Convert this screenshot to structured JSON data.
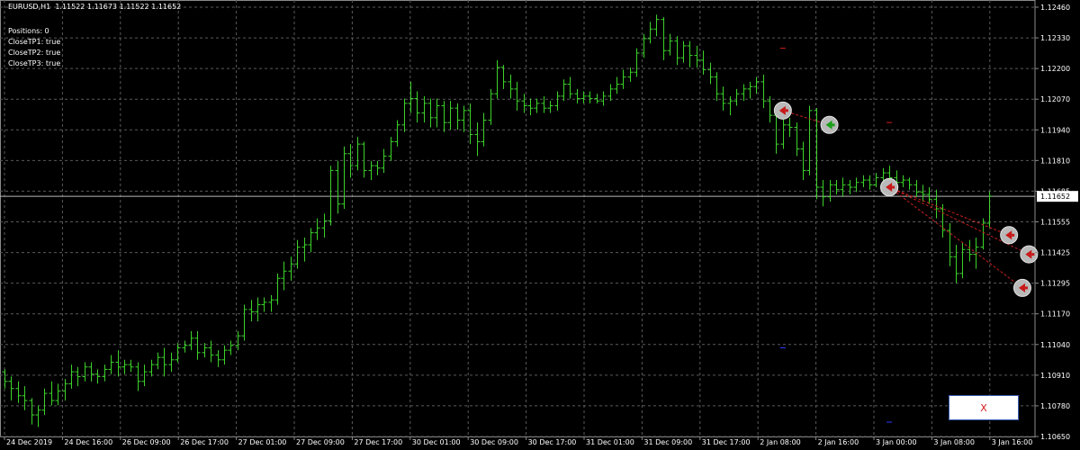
{
  "header": {
    "symbol": "EURUSD,H1",
    "ohlc": "1.11522 1.11673 1.11522 1.11652"
  },
  "info": {
    "lines": [
      "Positions: 0",
      "CloseTP1: true",
      "CloseTP2: true",
      "CloseTP3: true"
    ]
  },
  "close_button": {
    "label": "X"
  },
  "colors": {
    "background": "#000000",
    "grid": "#5a5a5a",
    "bar": "#3cd22a",
    "axis_text": "#ffffff",
    "price_tag_bg": "#ffffff",
    "price_tag_text": "#000000",
    "trade_line": "#c41e1e",
    "marker_fill": "#b9b9b9",
    "marker_arrow_green": "#18a018",
    "marker_arrow_red": "#c81818",
    "level_red": "#d81c1c",
    "level_blue": "#2a3cff"
  },
  "chart_data": {
    "type": "ohlc",
    "symbol": "EURUSD",
    "timeframe": "H1",
    "ylim": [
      1.1065,
      1.1246
    ],
    "y_ticks": [
      "1.12460",
      "1.12330",
      "1.12200",
      "1.12070",
      "1.11940",
      "1.11810",
      "1.11685",
      "1.11555",
      "1.11425",
      "1.11295",
      "1.11170",
      "1.11040",
      "1.10910",
      "1.10780",
      "1.10650"
    ],
    "x_ticks": [
      "24 Dec 2019",
      "24 Dec 16:00",
      "26 Dec 09:00",
      "26 Dec 17:00",
      "27 Dec 01:00",
      "27 Dec 09:00",
      "27 Dec 17:00",
      "30 Dec 01:00",
      "30 Dec 09:00",
      "30 Dec 17:00",
      "31 Dec 01:00",
      "31 Dec 09:00",
      "31 Dec 17:00",
      "2 Jan 08:00",
      "2 Jan 16:00",
      "3 Jan 00:00",
      "3 Jan 08:00",
      "3 Jan 16:00"
    ],
    "current_price": 1.11652,
    "current_price_label": "1.11652",
    "grid": true,
    "bars": [
      [
        1.1092,
        1.1093,
        1.1085,
        1.1088
      ],
      [
        1.1088,
        1.109,
        1.108,
        1.1085
      ],
      [
        1.1085,
        1.1088,
        1.1079,
        1.1082
      ],
      [
        1.1082,
        1.1086,
        1.1076,
        1.108
      ],
      [
        1.108,
        1.1081,
        1.107,
        1.1074
      ],
      [
        1.1074,
        1.1078,
        1.1069,
        1.1076
      ],
      [
        1.1076,
        1.1085,
        1.1074,
        1.1083
      ],
      [
        1.1083,
        1.1088,
        1.1078,
        1.108
      ],
      [
        1.108,
        1.1087,
        1.1078,
        1.1084
      ],
      [
        1.1084,
        1.1089,
        1.108,
        1.1087
      ],
      [
        1.1087,
        1.1095,
        1.1085,
        1.1092
      ],
      [
        1.1092,
        1.1094,
        1.1086,
        1.109
      ],
      [
        1.109,
        1.1096,
        1.1088,
        1.1094
      ],
      [
        1.1094,
        1.1096,
        1.1088,
        1.1091
      ],
      [
        1.1091,
        1.1093,
        1.1087,
        1.109
      ],
      [
        1.109,
        1.1095,
        1.1088,
        1.1093
      ],
      [
        1.1093,
        1.1099,
        1.1091,
        1.1096
      ],
      [
        1.1096,
        1.1101,
        1.109,
        1.1094
      ],
      [
        1.1094,
        1.1097,
        1.1091,
        1.1095
      ],
      [
        1.1095,
        1.1097,
        1.1092,
        1.1094
      ],
      [
        1.1094,
        1.1096,
        1.1084,
        1.1088
      ],
      [
        1.1088,
        1.1095,
        1.1086,
        1.1092
      ],
      [
        1.1092,
        1.1097,
        1.109,
        1.1095
      ],
      [
        1.1095,
        1.11,
        1.1093,
        1.1098
      ],
      [
        1.1098,
        1.1102,
        1.109,
        1.1095
      ],
      [
        1.1095,
        1.11,
        1.1092,
        1.1097
      ],
      [
        1.1097,
        1.1104,
        1.1096,
        1.1102
      ],
      [
        1.1102,
        1.1105,
        1.11,
        1.1103
      ],
      [
        1.1103,
        1.1109,
        1.1101,
        1.1106
      ],
      [
        1.1106,
        1.1109,
        1.1097,
        1.11
      ],
      [
        1.11,
        1.1104,
        1.1098,
        1.1102
      ],
      [
        1.1102,
        1.1105,
        1.1096,
        1.1099
      ],
      [
        1.1099,
        1.1101,
        1.1094,
        1.1097
      ],
      [
        1.1097,
        1.1103,
        1.1095,
        1.1101
      ],
      [
        1.1101,
        1.1105,
        1.1099,
        1.1103
      ],
      [
        1.1103,
        1.1109,
        1.1101,
        1.1107
      ],
      [
        1.1107,
        1.112,
        1.1105,
        1.1118
      ],
      [
        1.1118,
        1.1122,
        1.1113,
        1.1117
      ],
      [
        1.1117,
        1.1123,
        1.1113,
        1.112
      ],
      [
        1.112,
        1.1123,
        1.1117,
        1.1121
      ],
      [
        1.1121,
        1.1124,
        1.1117,
        1.1122
      ],
      [
        1.1122,
        1.1133,
        1.112,
        1.1131
      ],
      [
        1.1131,
        1.1138,
        1.1126,
        1.1134
      ],
      [
        1.1134,
        1.114,
        1.113,
        1.1137
      ],
      [
        1.1137,
        1.1147,
        1.1135,
        1.1144
      ],
      [
        1.1144,
        1.1148,
        1.1138,
        1.1145
      ],
      [
        1.1145,
        1.1152,
        1.1142,
        1.115
      ],
      [
        1.115,
        1.1156,
        1.1147,
        1.1152
      ],
      [
        1.1152,
        1.1158,
        1.1148,
        1.1155
      ],
      [
        1.1155,
        1.1178,
        1.1153,
        1.1176
      ],
      [
        1.1176,
        1.118,
        1.1158,
        1.1162
      ],
      [
        1.1162,
        1.1186,
        1.116,
        1.1183
      ],
      [
        1.1183,
        1.1187,
        1.1173,
        1.1178
      ],
      [
        1.1178,
        1.119,
        1.1176,
        1.1187
      ],
      [
        1.1187,
        1.1188,
        1.1173,
        1.1176
      ],
      [
        1.1176,
        1.118,
        1.1172,
        1.1178
      ],
      [
        1.1178,
        1.118,
        1.1174,
        1.1177
      ],
      [
        1.1177,
        1.1185,
        1.1175,
        1.1182
      ],
      [
        1.1182,
        1.119,
        1.118,
        1.1188
      ],
      [
        1.1188,
        1.1197,
        1.1186,
        1.1195
      ],
      [
        1.1195,
        1.1206,
        1.1192,
        1.1204
      ],
      [
        1.1204,
        1.1213,
        1.12,
        1.1206
      ],
      [
        1.1206,
        1.1209,
        1.1196,
        1.12
      ],
      [
        1.12,
        1.1207,
        1.1196,
        1.1204
      ],
      [
        1.1204,
        1.1206,
        1.1194,
        1.1198
      ],
      [
        1.1198,
        1.1206,
        1.1194,
        1.1203
      ],
      [
        1.1203,
        1.1205,
        1.1192,
        1.1196
      ],
      [
        1.1196,
        1.1205,
        1.1193,
        1.1202
      ],
      [
        1.1202,
        1.1204,
        1.1193,
        1.1197
      ],
      [
        1.1197,
        1.1203,
        1.1192,
        1.1201
      ],
      [
        1.1201,
        1.1204,
        1.1187,
        1.1191
      ],
      [
        1.1191,
        1.1196,
        1.1182,
        1.1188
      ],
      [
        1.1188,
        1.12,
        1.1186,
        1.1197
      ],
      [
        1.1197,
        1.121,
        1.1195,
        1.1208
      ],
      [
        1.1208,
        1.1222,
        1.1206,
        1.1219
      ],
      [
        1.1219,
        1.122,
        1.121,
        1.1213
      ],
      [
        1.1213,
        1.1216,
        1.1206,
        1.121
      ],
      [
        1.121,
        1.1213,
        1.1201,
        1.1205
      ],
      [
        1.1205,
        1.1208,
        1.12,
        1.1203
      ],
      [
        1.1203,
        1.1206,
        1.1199,
        1.1202
      ],
      [
        1.1202,
        1.1206,
        1.12,
        1.1204
      ],
      [
        1.1204,
        1.1207,
        1.12,
        1.1202
      ],
      [
        1.1202,
        1.1205,
        1.12,
        1.1203
      ],
      [
        1.1203,
        1.1209,
        1.1201,
        1.1207
      ],
      [
        1.1207,
        1.1214,
        1.1205,
        1.1212
      ],
      [
        1.1212,
        1.1215,
        1.1206,
        1.1208
      ],
      [
        1.1208,
        1.121,
        1.1204,
        1.1206
      ],
      [
        1.1206,
        1.1209,
        1.1204,
        1.1207
      ],
      [
        1.1207,
        1.1209,
        1.1204,
        1.1206
      ],
      [
        1.1206,
        1.1208,
        1.1204,
        1.1205
      ],
      [
        1.1205,
        1.1209,
        1.1203,
        1.1207
      ],
      [
        1.1207,
        1.1212,
        1.1205,
        1.121
      ],
      [
        1.121,
        1.1215,
        1.1208,
        1.1212
      ],
      [
        1.1212,
        1.1218,
        1.121,
        1.1215
      ],
      [
        1.1215,
        1.1219,
        1.1213,
        1.1217
      ],
      [
        1.1217,
        1.1227,
        1.1215,
        1.1225
      ],
      [
        1.1225,
        1.1233,
        1.1223,
        1.1231
      ],
      [
        1.1231,
        1.1238,
        1.1229,
        1.1235
      ],
      [
        1.1235,
        1.1241,
        1.1232,
        1.1239
      ],
      [
        1.1239,
        1.124,
        1.1222,
        1.1226
      ],
      [
        1.1226,
        1.1233,
        1.1224,
        1.123
      ],
      [
        1.123,
        1.1232,
        1.122,
        1.1223
      ],
      [
        1.1223,
        1.123,
        1.1221,
        1.1228
      ],
      [
        1.1228,
        1.123,
        1.1219,
        1.1224
      ],
      [
        1.1224,
        1.1228,
        1.1219,
        1.1222
      ],
      [
        1.1222,
        1.1226,
        1.1216,
        1.1218
      ],
      [
        1.1218,
        1.1221,
        1.1212,
        1.1215
      ],
      [
        1.1215,
        1.1217,
        1.1205,
        1.1208
      ],
      [
        1.1208,
        1.1211,
        1.1201,
        1.1204
      ],
      [
        1.1204,
        1.1207,
        1.1199,
        1.1205
      ],
      [
        1.1205,
        1.121,
        1.1203,
        1.1208
      ],
      [
        1.1208,
        1.1212,
        1.1205,
        1.121
      ],
      [
        1.121,
        1.1213,
        1.1206,
        1.1211
      ],
      [
        1.1211,
        1.1215,
        1.1208,
        1.1213
      ],
      [
        1.1213,
        1.1216,
        1.1202,
        1.1205
      ],
      [
        1.1205,
        1.1207,
        1.1196,
        1.1199
      ],
      [
        1.1199,
        1.12,
        1.1183,
        1.1187
      ],
      [
        1.1187,
        1.1198,
        1.1185,
        1.1195
      ],
      [
        1.1195,
        1.1198,
        1.119,
        1.1194
      ],
      [
        1.1194,
        1.1196,
        1.1182,
        1.1185
      ],
      [
        1.1185,
        1.1188,
        1.1172,
        1.1176
      ],
      [
        1.1176,
        1.1203,
        1.1174,
        1.1201
      ],
      [
        1.1201,
        1.1202,
        1.1164,
        1.1169
      ],
      [
        1.1169,
        1.1172,
        1.1161,
        1.1165
      ],
      [
        1.1165,
        1.1172,
        1.1163,
        1.117
      ],
      [
        1.117,
        1.1172,
        1.1166,
        1.1168
      ],
      [
        1.1168,
        1.1173,
        1.1165,
        1.117
      ],
      [
        1.117,
        1.1172,
        1.1166,
        1.1169
      ],
      [
        1.1169,
        1.1173,
        1.1167,
        1.1171
      ],
      [
        1.1171,
        1.1174,
        1.1169,
        1.1172
      ],
      [
        1.1172,
        1.1174,
        1.1168,
        1.117
      ],
      [
        1.117,
        1.1175,
        1.1169,
        1.1173
      ],
      [
        1.1173,
        1.1177,
        1.1171,
        1.1175
      ],
      [
        1.1175,
        1.1178,
        1.117,
        1.1173
      ],
      [
        1.1173,
        1.1176,
        1.1168,
        1.1171
      ],
      [
        1.1171,
        1.1174,
        1.1169,
        1.1172
      ],
      [
        1.1172,
        1.1173,
        1.1168,
        1.117
      ],
      [
        1.117,
        1.1172,
        1.1165,
        1.1167
      ],
      [
        1.1167,
        1.117,
        1.1163,
        1.1166
      ],
      [
        1.1166,
        1.1169,
        1.1162,
        1.1164
      ],
      [
        1.1164,
        1.1168,
        1.1156,
        1.116
      ],
      [
        1.116,
        1.1162,
        1.1148,
        1.1151
      ],
      [
        1.1151,
        1.1154,
        1.1136,
        1.114
      ],
      [
        1.114,
        1.1145,
        1.1129,
        1.1133
      ],
      [
        1.1133,
        1.1146,
        1.1131,
        1.1143
      ],
      [
        1.1143,
        1.1147,
        1.1138,
        1.1141
      ],
      [
        1.1141,
        1.1148,
        1.1135,
        1.1144
      ],
      [
        1.1144,
        1.1156,
        1.1143,
        1.1154
      ],
      [
        1.1154,
        1.11673,
        1.11522,
        1.11652
      ]
    ],
    "trades": [
      {
        "from": [
          117,
          1.1201
        ],
        "to": [
          124,
          1.1195
        ],
        "from_arrow": "red",
        "to_arrow": "green"
      },
      {
        "from": [
          133,
          1.1169
        ],
        "to": [
          151,
          1.1149
        ],
        "from_arrow": "red",
        "to_arrow": "red"
      },
      {
        "from": [
          133,
          1.1169
        ],
        "to": [
          154,
          1.1141
        ],
        "from_arrow": "red",
        "to_arrow": "red"
      },
      {
        "from": [
          133,
          1.1169
        ],
        "to": [
          153,
          1.1127
        ],
        "from_arrow": "red",
        "to_arrow": "red"
      }
    ],
    "level_marks": [
      {
        "index": 117,
        "price": 1.1227,
        "color": "red"
      },
      {
        "index": 133,
        "price": 1.1196,
        "color": "red"
      },
      {
        "index": 117,
        "price": 1.1102,
        "color": "blue"
      },
      {
        "index": 133,
        "price": 1.1071,
        "color": "blue"
      }
    ]
  }
}
